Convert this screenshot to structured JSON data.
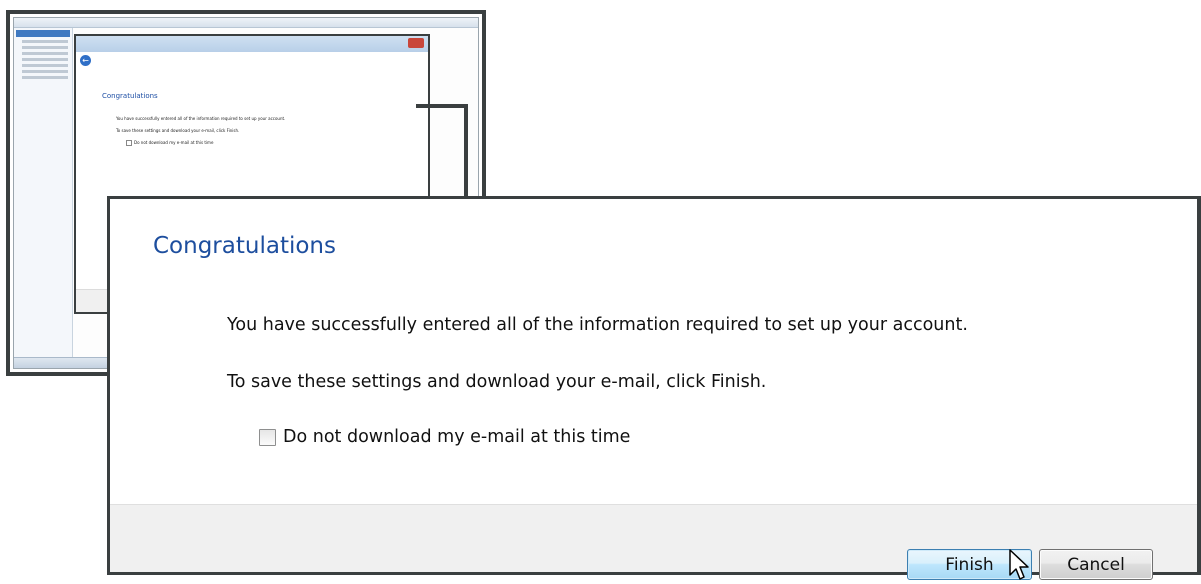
{
  "dialog": {
    "heading": "Congratulations",
    "message_line1": "You have successfully entered all of the information required to set up your account.",
    "message_line2": "To save these settings and download your e-mail, click Finish.",
    "checkbox_label": "Do not download my e-mail at this time",
    "checkbox_checked": false,
    "finish_label": "Finish",
    "cancel_label": "Cancel"
  },
  "thumbnail": {
    "heading": "Congratulations",
    "message_line1": "You have successfully entered all of the information required to set up your account.",
    "message_line2": "To save these settings and download your e-mail, click Finish.",
    "checkbox_label": "Do not download my e-mail at this time",
    "back_icon": "back-arrow-icon",
    "close_icon": "close-icon"
  },
  "colors": {
    "heading": "#1d4e9e",
    "frame": "#3a3f40",
    "footer": "#f0f0f0",
    "finish_button": "#bee6fd"
  },
  "icons": {
    "cursor": "mouse-pointer-icon"
  }
}
